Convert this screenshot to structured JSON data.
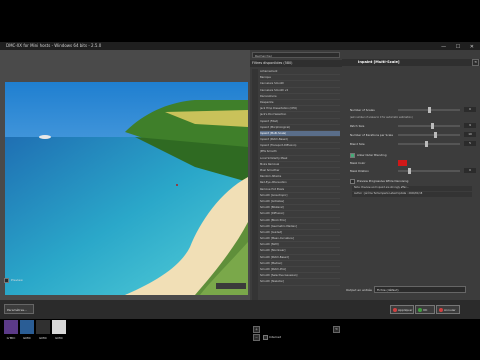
{
  "window": {
    "title": "DMC-XX for Mini hosts - Windows 64 bits - 2.5.0",
    "controls": "— ☐ ✕"
  },
  "preview": {
    "zoom": "",
    "preview_check_label": "Preview"
  },
  "logos": [
    {
      "name": "G'MIC",
      "color": "#5b3a88"
    },
    {
      "name": "GMIC",
      "color": "#2a5d95"
    },
    {
      "name": "GMIC",
      "color": "#303030"
    },
    {
      "name": "GMIC",
      "color": "#d8d8d8"
    }
  ],
  "statusbar": {
    "settings_label": "Paramètres..."
  },
  "filters": {
    "search_placeholder": "Rechercher",
    "header": "Filtres disponibles (580)",
    "items": [
      "Acharnement",
      "Baroque",
      "Cannelure Smooth",
      "Cannelure Smooth v2",
      "Déconstruire",
      "Déspeckle",
      "Jack Hmp Dissertation (CEO)",
      "Jack's Pool Selection",
      "Inpaint (Fillet)",
      "Inpaint (Morphological)",
      "Inpaint (Multi-Scale)",
      "Inpaint (Patch-Based)",
      "Inpaint (Transport-Diffusion)",
      "JPEG Smooth",
      "Local Similarity Mask",
      "Moire Removal",
      "Pixel Smoother",
      "Random Attacks",
      "Red-Eye Attenuation",
      "Remove Hot Pixels",
      "Smooth [Anisotropic]",
      "Smooth [Antialias]",
      "Smooth [Bilateral]",
      "Smooth [Diffusion]",
      "Smooth [Block PCA]",
      "Smooth [Geometric-Median]",
      "Smooth [Guided]",
      "Smooth [Mean-Curvature]",
      "Smooth [NLM]",
      "Smooth [Nonlinear]",
      "Smooth [Patch-Based]",
      "Smooth [Median]",
      "Smooth [Patch-PCA]",
      "Smooth [Selective Gaussian]",
      "Smooth [Skeleton]"
    ],
    "selected_index": 10,
    "internet_label": "Internet"
  },
  "params": {
    "title": "Inpaint [Multi-Scale]",
    "rows": [
      {
        "label": "Number of Scales",
        "value": "0",
        "level": 0.5
      },
      {
        "label": "(set number of scales to 0 for automatic estimation)",
        "value": null,
        "level": null
      },
      {
        "label": "Patch Size",
        "value": "9",
        "level": 0.55
      },
      {
        "label": "Number of Iterations per Scale",
        "value": "10",
        "level": 0.6
      },
      {
        "label": "Blend Size",
        "value": "5",
        "level": 0.45
      }
    ],
    "allow_outer_blending": "Allow Outer Blending",
    "mask_color_label": "Mask Color",
    "mask_color": "#d01818",
    "mask_dilation_label": "Mask Dilation",
    "mask_dilation_value": "0",
    "preview_progressive_label": "Preview Progressive While Denoising",
    "note1": "Note: Preview and Inpaint are strongly affec...",
    "note2": "Author : Jérôme Tschumperlé    Latest Update : 2020/01/18"
  },
  "output": {
    "label": "Output en entrée",
    "selected": "Fichie (défaut)"
  },
  "buttons": {
    "apply": "Appliquer",
    "ok": "OK",
    "cancel": "Annuler",
    "apply_color": "#d04040",
    "ok_color": "#40a040",
    "cancel_color": "#d04040"
  }
}
